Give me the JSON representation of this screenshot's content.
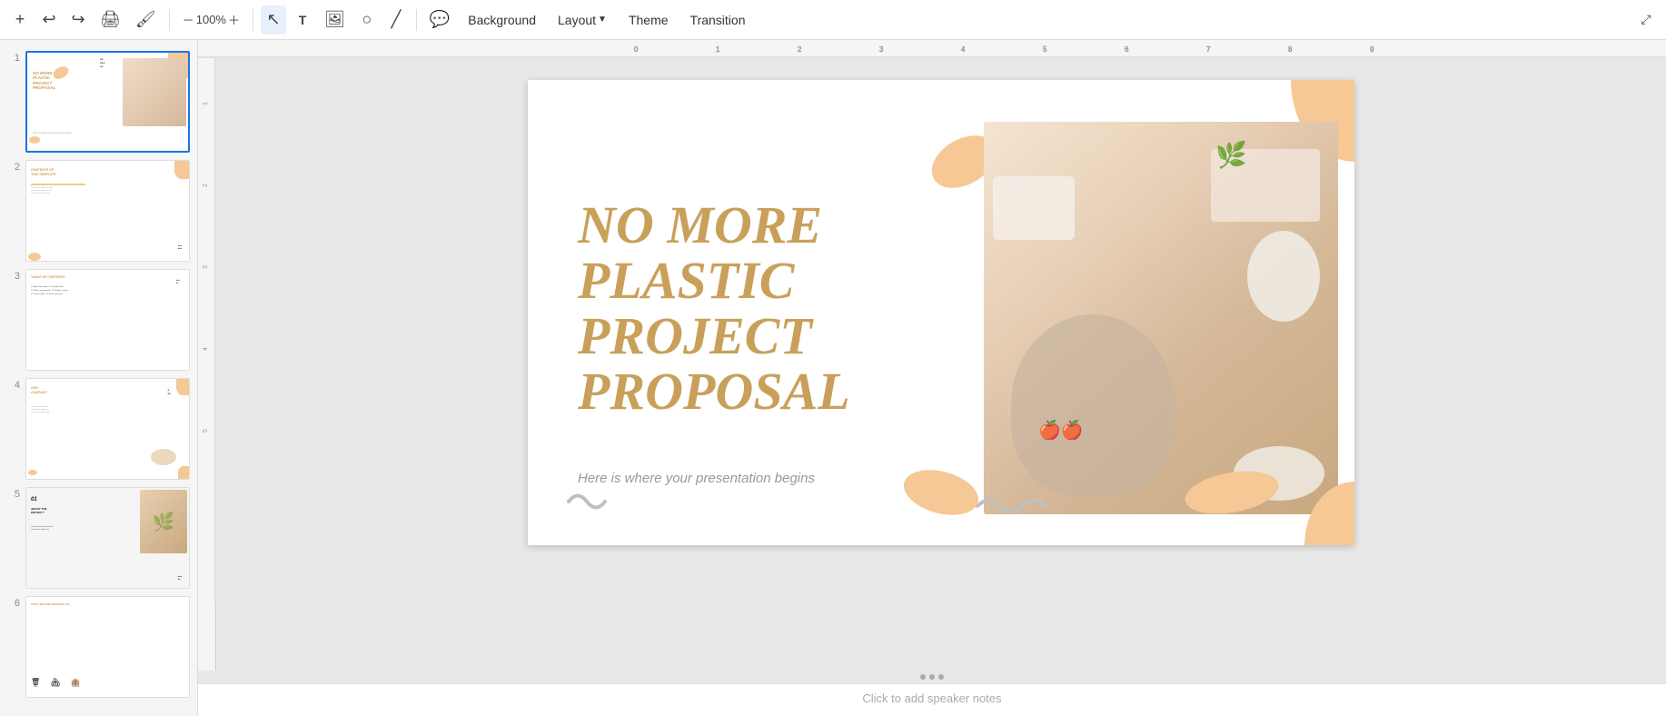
{
  "toolbar": {
    "add_label": "+",
    "undo_label": "↩",
    "redo_label": "↪",
    "print_label": "🖨",
    "format_paint_label": "🖌",
    "zoom_label": "100%",
    "select_label": "↖",
    "textbox_label": "T",
    "image_label": "🖼",
    "shape_label": "○",
    "line_label": "/",
    "comment_label": "💬",
    "background_label": "Background",
    "layout_label": "Layout",
    "theme_label": "Theme",
    "transition_label": "Transition",
    "maximize_label": "⤢"
  },
  "slides": [
    {
      "number": "1",
      "active": true
    },
    {
      "number": "2",
      "active": false
    },
    {
      "number": "3",
      "active": false
    },
    {
      "number": "4",
      "active": false
    },
    {
      "number": "5",
      "active": false
    },
    {
      "number": "6",
      "active": false
    }
  ],
  "main_slide": {
    "title_line1": "NO MORE",
    "title_line2": "PLASTIC",
    "title_line3": "PROJECT",
    "title_line4": "PROPOSAL",
    "subtitle": "Here is where your presentation begins"
  },
  "slide2": {
    "heading": "CONTENTS OF THIS TEMPLATE"
  },
  "slide3": {
    "heading": "TABLE OF CONTENTS",
    "items": [
      "01 About the project",
      "02 Major requirements",
      "03 Project goals",
      "04 Growth path",
      "05 Projects stages",
      "06 Know our team"
    ]
  },
  "slide4": {
    "heading": "OUR COMPANY"
  },
  "slide5": {
    "heading": "01 ABOUT THE PROJECT"
  },
  "slide6": {
    "heading": "WHAT WE ARE WORKING ON"
  },
  "notes": {
    "placeholder": "Click to add speaker notes"
  },
  "colors": {
    "gold": "#c9a05a",
    "light_peach": "#f5c896",
    "gray_squiggle": "#c0c0c0",
    "dark_dots": "#333333",
    "bg": "#ffffff"
  }
}
